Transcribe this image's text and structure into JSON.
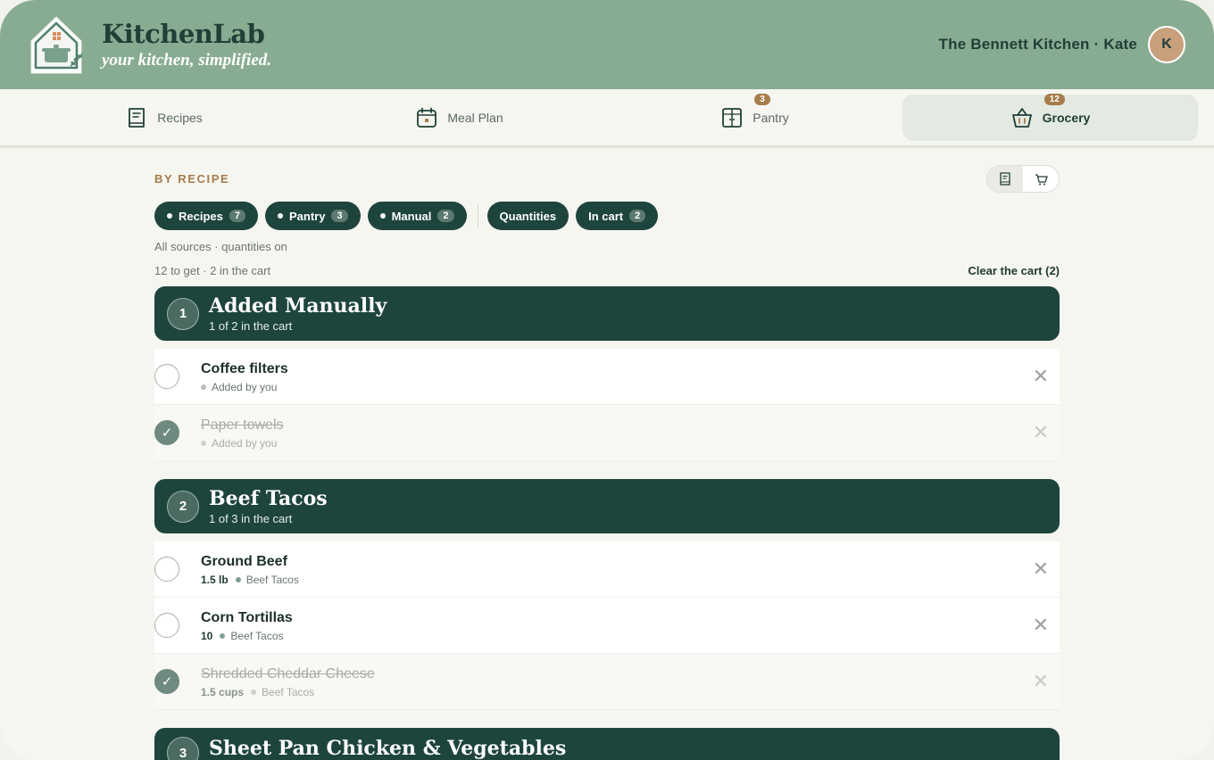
{
  "app": {
    "name": "KitchenLab",
    "tagline": "your kitchen, simplified.",
    "user_label": "The Bennett Kitchen · Kate",
    "avatar_initial": "K"
  },
  "nav": {
    "items": [
      {
        "label": "Recipes",
        "icon": "recipe-book-icon",
        "badge": ""
      },
      {
        "label": "Meal Plan",
        "icon": "calendar-icon",
        "badge": ""
      },
      {
        "label": "Pantry",
        "icon": "pantry-cabinet-icon",
        "badge": "3"
      },
      {
        "label": "Grocery",
        "icon": "basket-icon",
        "badge": "12",
        "active": true
      }
    ]
  },
  "grocery": {
    "section_label": "BY RECIPE",
    "view_toggle": [
      "list-book-icon",
      "cart-icon"
    ],
    "filters": [
      {
        "label": "Recipes",
        "count": "7"
      },
      {
        "label": "Pantry",
        "count": "3"
      },
      {
        "label": "Manual",
        "count": "2"
      }
    ],
    "toggles": [
      {
        "label": "Quantities",
        "count": ""
      },
      {
        "label": "In cart",
        "count": "2"
      }
    ],
    "summary": "All sources · quantities on",
    "count_text": "12 to get · 2 in the cart",
    "clear_label": "Clear the cart (2)",
    "groups": [
      {
        "number": "1",
        "title": "Added Manually",
        "subtitle": "1 of 2 in the cart",
        "items": [
          {
            "name": "Coffee filters",
            "qty": "",
            "source": "Added by you",
            "done": false
          },
          {
            "name": "Paper towels",
            "qty": "",
            "source": "Added by you",
            "done": true
          }
        ]
      },
      {
        "number": "2",
        "title": "Beef Tacos",
        "subtitle": "1 of 3 in the cart",
        "items": [
          {
            "name": "Ground Beef",
            "qty": "1.5 lb",
            "source": "Beef Tacos",
            "done": false
          },
          {
            "name": "Corn Tortillas",
            "qty": "10",
            "source": "Beef Tacos",
            "done": false
          },
          {
            "name": "Shredded Cheddar Cheese",
            "qty": "1.5 cups",
            "source": "Beef Tacos",
            "done": true
          }
        ]
      },
      {
        "number": "3",
        "title": "Sheet Pan Chicken & Vegetables",
        "subtitle": "",
        "items": []
      }
    ],
    "remove_glyph": "✕",
    "check_glyph": "✓"
  },
  "colors": {
    "header_bg": "#88ac92",
    "accent_dark": "#1e453d",
    "accent_brown": "#a67c4b"
  }
}
